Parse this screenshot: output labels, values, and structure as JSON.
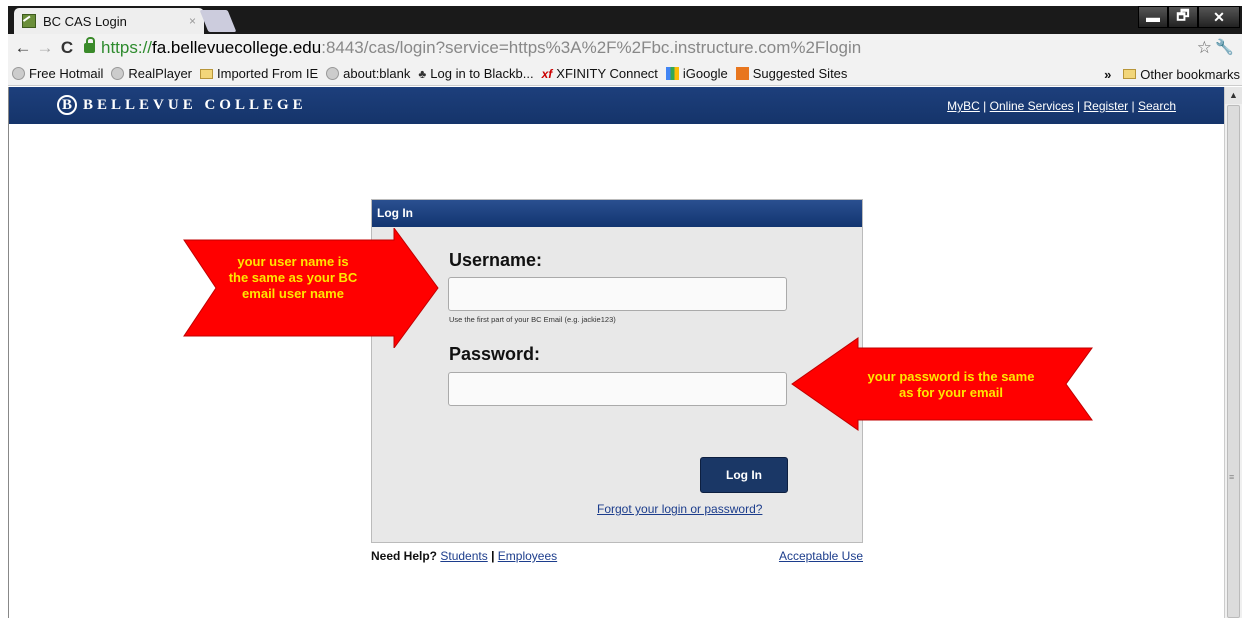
{
  "browser": {
    "tab_title": "BC CAS Login",
    "tab_close": "×",
    "window_buttons": {
      "minimize": "▬",
      "restore": "🗗",
      "close": "✕"
    },
    "url": {
      "scheme": "https://",
      "host": "fa.bellevuecollege.edu",
      "path": ":8443/cas/login?service=https%3A%2F%2Fbc.instructure.com%2Flogin"
    },
    "bookmarks": [
      {
        "label": "Free Hotmail",
        "icon": "globe-icon"
      },
      {
        "label": "RealPlayer",
        "icon": "globe-icon"
      },
      {
        "label": "Imported From IE",
        "icon": "folder-icon"
      },
      {
        "label": "about:blank",
        "icon": "globe-icon"
      },
      {
        "label": "Log in to Blackb...",
        "icon": "person-icon"
      },
      {
        "label": "XFINITY Connect",
        "icon": "xfinity-icon"
      },
      {
        "label": "iGoogle",
        "icon": "igoogle-icon"
      },
      {
        "label": "Suggested Sites",
        "icon": "suggested-icon"
      }
    ],
    "bookmarks_overflow": "»",
    "other_bookmarks": "Other bookmarks"
  },
  "site": {
    "logo_letter": "B",
    "name": "BELLEVUE COLLEGE",
    "links": [
      "MyBC",
      "Online Services",
      "Register",
      "Search"
    ],
    "link_sep": " | "
  },
  "login": {
    "header": "Log In",
    "username_label": "Username:",
    "username_value": "",
    "username_hint": "Use the first part of your BC Email (e.g. jackie123)",
    "password_label": "Password:",
    "password_value": "",
    "submit": "Log In",
    "forgot": "Forgot your login or password?"
  },
  "help": {
    "need_help": "Need Help?",
    "students": "Students",
    "sep": " | ",
    "employees": "Employees",
    "acceptable_use": "Acceptable Use"
  },
  "annotations": {
    "left_arrow": [
      "your user name is",
      "the same as your BC",
      "email user name"
    ],
    "right_arrow": [
      "your password is the same",
      "as for your email"
    ],
    "arrow_color": "#ff0000",
    "text_color": "#ffe600"
  }
}
